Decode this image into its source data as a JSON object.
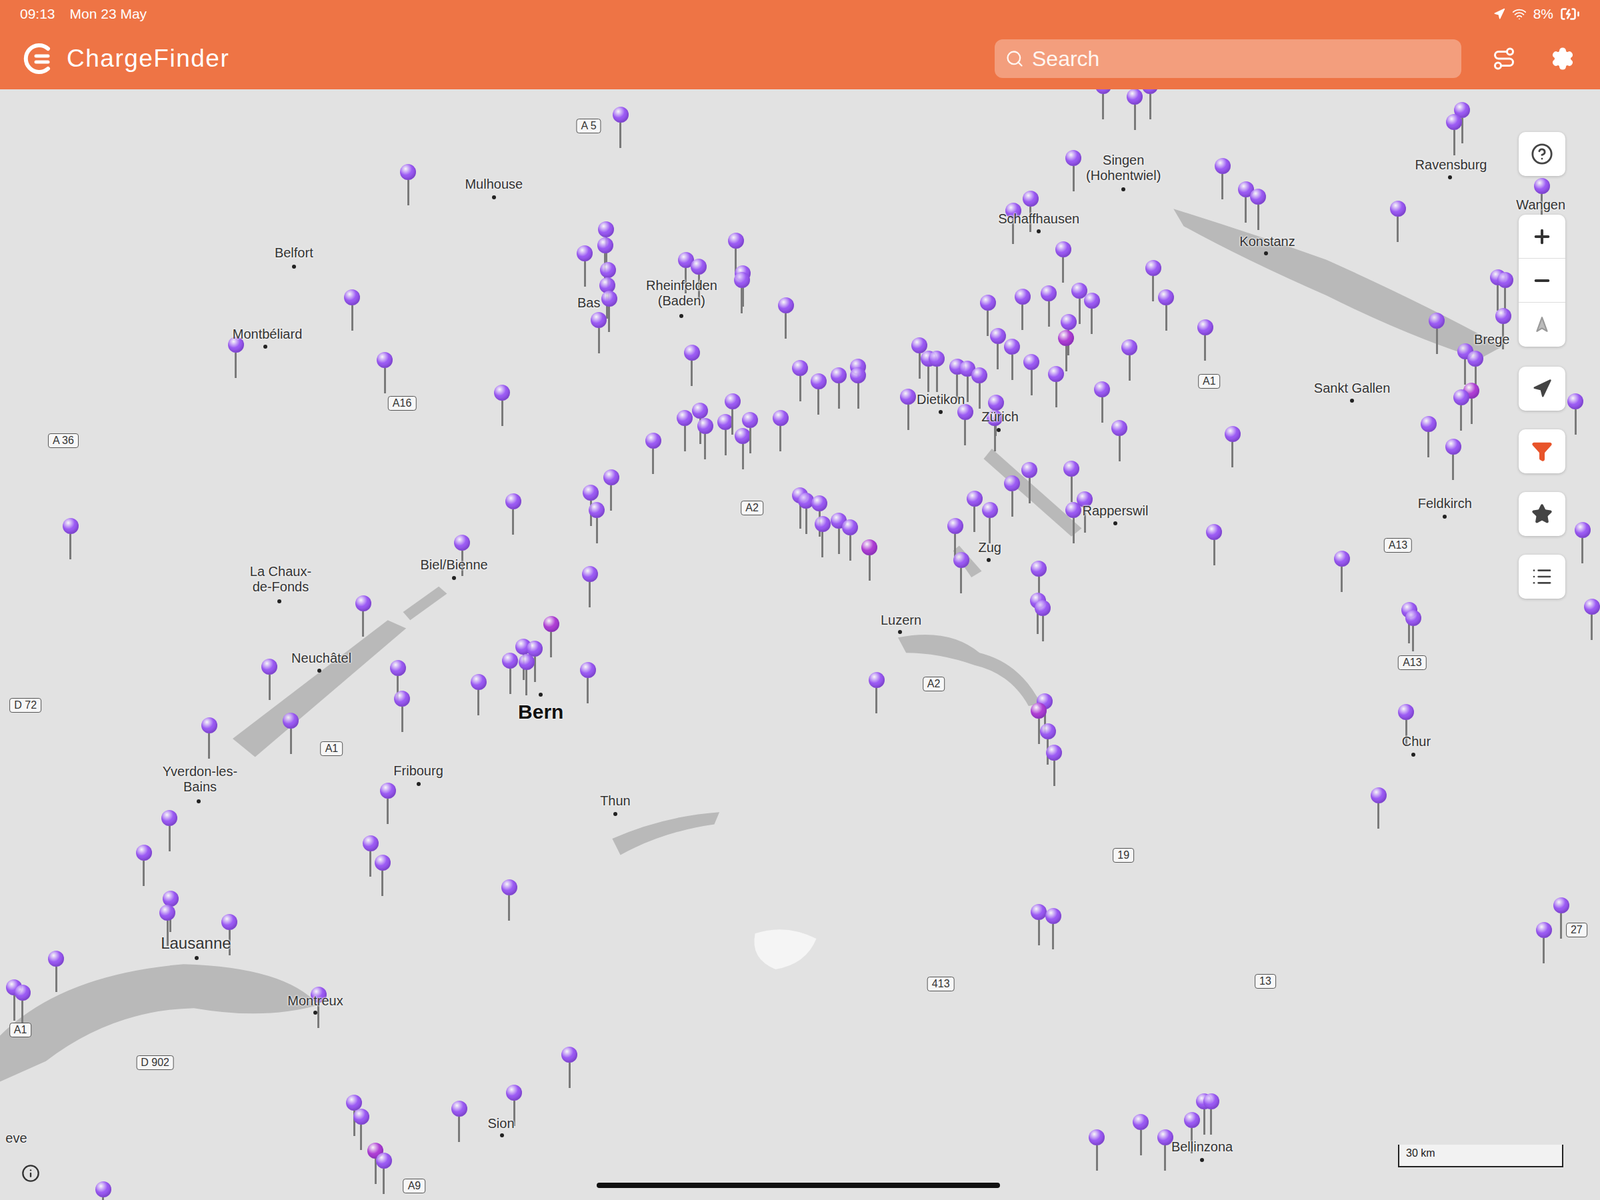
{
  "status_bar": {
    "time": "09:13",
    "date": "Mon 23 May",
    "battery": "8%"
  },
  "app_bar": {
    "title": "ChargeFinder",
    "search": {
      "placeholder": "Search"
    }
  },
  "map": {
    "cities": [
      {
        "text": "Mulhouse"
      },
      {
        "text": "Belfort"
      },
      {
        "text": "Montbéliard"
      },
      {
        "text": "Rheinfelden (Baden)"
      },
      {
        "text": "Singen (Hohentwiel)"
      },
      {
        "text": "Schaffhausen"
      },
      {
        "text": "Konstanz"
      },
      {
        "text": "Ravensburg"
      },
      {
        "text": "Wangen"
      },
      {
        "text": "Brege"
      },
      {
        "text": "Sankt Gallen"
      },
      {
        "text": "Feldkirch"
      },
      {
        "text": "Dietikon"
      },
      {
        "text": "Zürich"
      },
      {
        "text": "Rapperswil"
      },
      {
        "text": "Zug"
      },
      {
        "text": "Luzern"
      },
      {
        "text": "Bas"
      },
      {
        "text": "Biel/Bienne"
      },
      {
        "text": "La Chaux-de-Fonds"
      },
      {
        "text": "Neuchâtel"
      },
      {
        "text": "Bern"
      },
      {
        "text": "Fribourg"
      },
      {
        "text": "Yverdon-les-Bains"
      },
      {
        "text": "Thun"
      },
      {
        "text": "Lausanne"
      },
      {
        "text": "Montreux"
      },
      {
        "text": "Sion"
      },
      {
        "text": "Bellinzona"
      },
      {
        "text": "Chur"
      },
      {
        "text": "eve"
      }
    ],
    "roads": [
      {
        "text": "A 5"
      },
      {
        "text": "A16"
      },
      {
        "text": "A 36"
      },
      {
        "text": "D 72"
      },
      {
        "text": "A1"
      },
      {
        "text": "A2"
      },
      {
        "text": "A2"
      },
      {
        "text": "A1"
      },
      {
        "text": "A13"
      },
      {
        "text": "A13"
      },
      {
        "text": "19"
      },
      {
        "text": "413"
      },
      {
        "text": "13"
      },
      {
        "text": "27"
      },
      {
        "text": "D 902"
      },
      {
        "text": "A9"
      },
      {
        "text": "A1"
      }
    ],
    "pins": [
      {
        "color": "#9d5cf5"
      },
      {
        "color": "#9d5cf5"
      },
      {
        "color": "#9d5cf5"
      },
      {
        "color": "#9d5cf5"
      },
      {
        "color": "#9d5cf5"
      },
      {
        "color": "#9d5cf5"
      },
      {
        "color": "#9d5cf5"
      },
      {
        "color": "#9d5cf5"
      },
      {
        "color": "#9d5cf5"
      },
      {
        "color": "#9d5cf5"
      },
      {
        "color": "#9d5cf5"
      },
      {
        "color": "#9d5cf5"
      },
      {
        "color": "#9d5cf5"
      },
      {
        "color": "#9d5cf5"
      },
      {
        "color": "#9d5cf5"
      },
      {
        "color": "#9d5cf5"
      },
      {
        "color": "#9d5cf5"
      },
      {
        "color": "#9d5cf5"
      },
      {
        "color": "#9d5cf5"
      },
      {
        "color": "#9d5cf5"
      },
      {
        "color": "#9d5cf5"
      },
      {
        "color": "#9d5cf5"
      },
      {
        "color": "#9d5cf5"
      },
      {
        "color": "#9d5cf5"
      },
      {
        "color": "#9d5cf5"
      },
      {
        "color": "#9d5cf5"
      },
      {
        "color": "#9d5cf5"
      },
      {
        "color": "#9d5cf5"
      },
      {
        "color": "#9d5cf5"
      },
      {
        "color": "#9d5cf5"
      },
      {
        "color": "#9d5cf5"
      },
      {
        "color": "#9d5cf5"
      },
      {
        "color": "#9d5cf5"
      },
      {
        "color": "#9d5cf5"
      },
      {
        "color": "#9d5cf5"
      },
      {
        "color": "#9d5cf5"
      },
      {
        "color": "#9d5cf5"
      },
      {
        "color": "#9d5cf5"
      },
      {
        "color": "#b13fd6"
      },
      {
        "color": "#9d5cf5"
      },
      {
        "color": "#9d5cf5"
      },
      {
        "color": "#9d5cf5"
      },
      {
        "color": "#9d5cf5"
      },
      {
        "color": "#9d5cf5"
      },
      {
        "color": "#9d5cf5"
      },
      {
        "color": "#9d5cf5"
      },
      {
        "color": "#9d5cf5"
      },
      {
        "color": "#9d5cf5"
      },
      {
        "color": "#9d5cf5"
      },
      {
        "color": "#9d5cf5"
      },
      {
        "color": "#9d5cf5"
      },
      {
        "color": "#9d5cf5"
      },
      {
        "color": "#9d5cf5"
      },
      {
        "color": "#9d5cf5"
      },
      {
        "color": "#9d5cf5"
      },
      {
        "color": "#9d5cf5"
      },
      {
        "color": "#9d5cf5"
      },
      {
        "color": "#9d5cf5"
      },
      {
        "color": "#9d5cf5"
      },
      {
        "color": "#9d5cf5"
      },
      {
        "color": "#9d5cf5"
      },
      {
        "color": "#b13fd6"
      },
      {
        "color": "#9d5cf5"
      },
      {
        "color": "#9d5cf5"
      },
      {
        "color": "#9d5cf5"
      },
      {
        "color": "#9d5cf5"
      },
      {
        "color": "#9d5cf5"
      },
      {
        "color": "#9d5cf5"
      },
      {
        "color": "#9d5cf5"
      },
      {
        "color": "#9d5cf5"
      },
      {
        "color": "#9d5cf5"
      },
      {
        "color": "#9d5cf5"
      },
      {
        "color": "#9d5cf5"
      },
      {
        "color": "#9d5cf5"
      },
      {
        "color": "#9d5cf5"
      },
      {
        "color": "#9d5cf5"
      },
      {
        "color": "#9d5cf5"
      },
      {
        "color": "#9d5cf5"
      },
      {
        "color": "#9d5cf5"
      },
      {
        "color": "#9d5cf5"
      },
      {
        "color": "#9d5cf5"
      },
      {
        "color": "#9d5cf5"
      },
      {
        "color": "#9d5cf5"
      },
      {
        "color": "#9d5cf5"
      },
      {
        "color": "#9d5cf5"
      },
      {
        "color": "#9d5cf5"
      },
      {
        "color": "#9d5cf5"
      },
      {
        "color": "#9d5cf5"
      },
      {
        "color": "#9d5cf5"
      },
      {
        "color": "#9d5cf5"
      },
      {
        "color": "#9d5cf5"
      },
      {
        "color": "#9d5cf5"
      },
      {
        "color": "#9d5cf5"
      },
      {
        "color": "#9d5cf5"
      },
      {
        "color": "#9d5cf5"
      },
      {
        "color": "#9d5cf5"
      },
      {
        "color": "#9d5cf5"
      },
      {
        "color": "#9d5cf5"
      },
      {
        "color": "#9d5cf5"
      },
      {
        "color": "#9d5cf5"
      },
      {
        "color": "#b13fd6"
      },
      {
        "color": "#9d5cf5"
      },
      {
        "color": "#9d5cf5"
      },
      {
        "color": "#9d5cf5"
      },
      {
        "color": "#9d5cf5"
      },
      {
        "color": "#9d5cf5"
      },
      {
        "color": "#9d5cf5"
      },
      {
        "color": "#9d5cf5"
      },
      {
        "color": "#9d5cf5"
      },
      {
        "color": "#9d5cf5"
      },
      {
        "color": "#9d5cf5"
      },
      {
        "color": "#9d5cf5"
      },
      {
        "color": "#9d5cf5"
      },
      {
        "color": "#9d5cf5"
      },
      {
        "color": "#9d5cf5"
      },
      {
        "color": "#9d5cf5"
      },
      {
        "color": "#9d5cf5"
      },
      {
        "color": "#9d5cf5"
      },
      {
        "color": "#9d5cf5"
      },
      {
        "color": "#b13fd6"
      },
      {
        "color": "#9d5cf5"
      },
      {
        "color": "#9d5cf5"
      },
      {
        "color": "#9d5cf5"
      },
      {
        "color": "#9d5cf5"
      },
      {
        "color": "#9d5cf5"
      },
      {
        "color": "#9d5cf5"
      },
      {
        "color": "#9d5cf5"
      },
      {
        "color": "#9d5cf5"
      },
      {
        "color": "#9d5cf5"
      },
      {
        "color": "#9d5cf5"
      },
      {
        "color": "#9d5cf5"
      },
      {
        "color": "#b13fd6"
      },
      {
        "color": "#9d5cf5"
      },
      {
        "color": "#9d5cf5"
      },
      {
        "color": "#9d5cf5"
      },
      {
        "color": "#9d5cf5"
      },
      {
        "color": "#9d5cf5"
      },
      {
        "color": "#9d5cf5"
      },
      {
        "color": "#9d5cf5"
      },
      {
        "color": "#9d5cf5"
      },
      {
        "color": "#9d5cf5"
      },
      {
        "color": "#9d5cf5"
      },
      {
        "color": "#9d5cf5"
      },
      {
        "color": "#9d5cf5"
      },
      {
        "color": "#9d5cf5"
      },
      {
        "color": "#9d5cf5"
      },
      {
        "color": "#9d5cf5"
      },
      {
        "color": "#9d5cf5"
      },
      {
        "color": "#9d5cf5"
      },
      {
        "color": "#9d5cf5"
      },
      {
        "color": "#9d5cf5"
      },
      {
        "color": "#9d5cf5"
      },
      {
        "color": "#9d5cf5"
      },
      {
        "color": "#9d5cf5"
      },
      {
        "color": "#9d5cf5"
      },
      {
        "color": "#9d5cf5"
      },
      {
        "color": "#9d5cf5"
      },
      {
        "color": "#9d5cf5"
      },
      {
        "color": "#9d5cf5"
      },
      {
        "color": "#9d5cf5"
      },
      {
        "color": "#b13fd6"
      },
      {
        "color": "#9d5cf5"
      },
      {
        "color": "#9d5cf5"
      },
      {
        "color": "#9d5cf5"
      },
      {
        "color": "#9d5cf5"
      },
      {
        "color": "#9d5cf5"
      },
      {
        "color": "#9d5cf5"
      },
      {
        "color": "#9d5cf5"
      },
      {
        "color": "#9d5cf5"
      },
      {
        "color": "#9d5cf5"
      }
    ],
    "scale": "30 km"
  }
}
